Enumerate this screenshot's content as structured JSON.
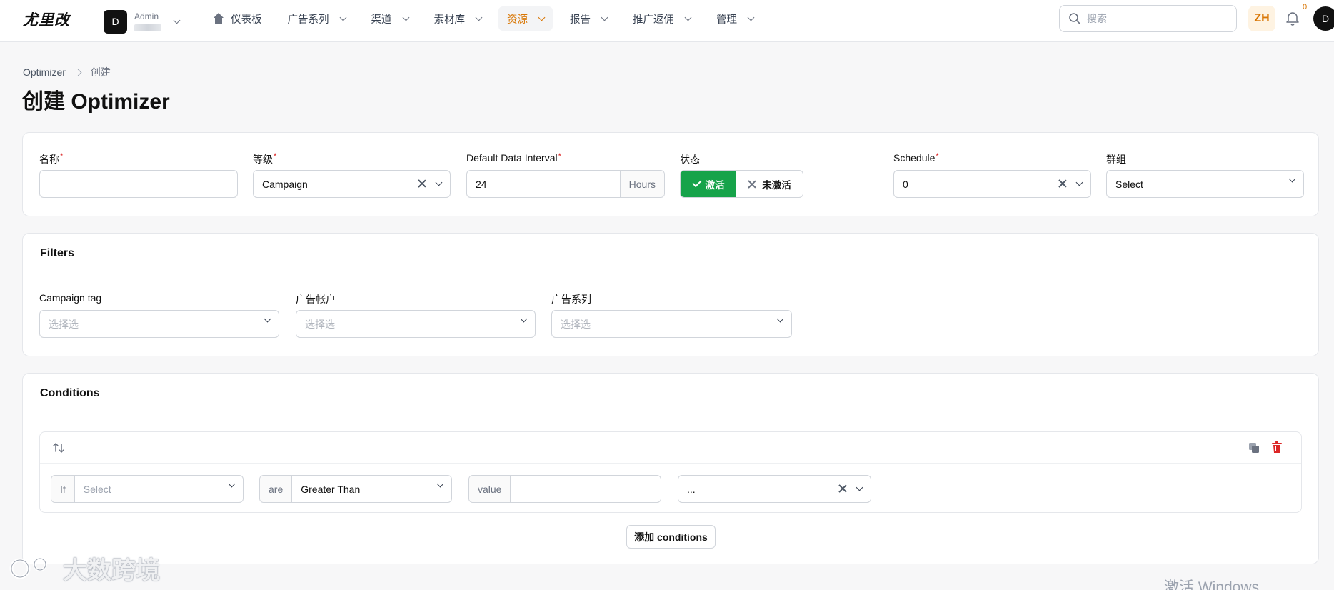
{
  "app": {
    "logo_text": "尤里改",
    "tenant_initial": "D",
    "tenant_name": "Admin"
  },
  "nav": {
    "items": [
      {
        "label": "仪表板",
        "icon": "home-icon",
        "dropdown": false,
        "active": false
      },
      {
        "label": "广告系列",
        "dropdown": true,
        "active": false
      },
      {
        "label": "渠道",
        "dropdown": true,
        "active": false
      },
      {
        "label": "素材库",
        "dropdown": true,
        "active": false
      },
      {
        "label": "资源",
        "dropdown": true,
        "active": true
      },
      {
        "label": "报告",
        "dropdown": true,
        "active": false
      },
      {
        "label": "推广返佣",
        "dropdown": true,
        "active": false
      },
      {
        "label": "管理",
        "dropdown": true,
        "active": false
      }
    ],
    "search_placeholder": "搜索",
    "lang": "ZH",
    "notification_count": "0",
    "user_initial": "D"
  },
  "breadcrumb": {
    "root": "Optimizer",
    "current": "创建"
  },
  "page": {
    "title": "创建 Optimizer"
  },
  "general": {
    "name": {
      "label": "名称",
      "value": ""
    },
    "level": {
      "label": "等级",
      "value": "Campaign"
    },
    "interval": {
      "label": "Default Data Interval",
      "value": "24",
      "unit": "Hours"
    },
    "status": {
      "label": "状态",
      "active_label": "激活",
      "inactive_label": "未激活",
      "selected": "active"
    },
    "schedule": {
      "label": "Schedule",
      "value": "0"
    },
    "group": {
      "label": "群组",
      "placeholder": "Select"
    }
  },
  "filters": {
    "title": "Filters",
    "campaign_tag": {
      "label": "Campaign tag",
      "placeholder": "选择选"
    },
    "ad_account": {
      "label": "广告帐户",
      "placeholder": "选择选"
    },
    "campaign": {
      "label": "广告系列",
      "placeholder": "选择选"
    }
  },
  "conditions": {
    "title": "Conditions",
    "row": {
      "if_label": "If",
      "metric_placeholder": "Select",
      "are_label": "are",
      "operator": "Greater Than",
      "value_label": "value",
      "value": "",
      "extra_value": "..."
    },
    "add_label": "添加 conditions"
  },
  "overlay": {
    "watermark": "大数跨境",
    "windows_note": "激活 Windows"
  },
  "colors": {
    "accent": "#d97706",
    "active_green": "#16a34a",
    "danger": "#dc2626"
  }
}
